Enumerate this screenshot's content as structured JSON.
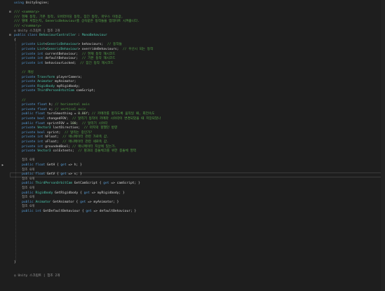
{
  "colors": {
    "background": "#1e1e1e",
    "comment": "#57a64a",
    "keyword": "#569cd6",
    "type": "#4ec9b0",
    "plain": "#d4d4d4",
    "method": "#dcdcaa",
    "number": "#b5cea8",
    "reference": "#9b9b9b"
  },
  "lines": [
    {
      "fold": "",
      "tokens": [
        {
          "c": "t-kw",
          "t": "using"
        },
        {
          "c": "t-plain",
          "t": " UnityEngine;"
        }
      ]
    },
    {
      "fold": "",
      "tokens": []
    },
    {
      "fold": "⊟",
      "tokens": [
        {
          "c": "t-comment",
          "t": "/// <summary>"
        }
      ]
    },
    {
      "fold": "",
      "tokens": [
        {
          "c": "t-comment",
          "t": "/// 현재 동작, 기본 동작, 오버라이딩 동작, 잠긴 동작, 마우스 이동값,"
        }
      ]
    },
    {
      "fold": "",
      "tokens": [
        {
          "c": "t-comment",
          "t": "/// 땅에 서있는지, GenericBehaviour를 상속받은 동작들을 업데이트 시켜줍니다."
        }
      ]
    },
    {
      "fold": "",
      "tokens": [
        {
          "c": "t-comment",
          "t": "/// </summary>"
        }
      ]
    },
    {
      "fold": "",
      "tokens": [
        {
          "c": "t-ref",
          "t": "◎ Unity 스크립트 | 참조 2개"
        }
      ]
    },
    {
      "fold": "⊟",
      "tokens": [
        {
          "c": "t-kw",
          "t": "public class "
        },
        {
          "c": "t-type",
          "t": "BehaviourController"
        },
        {
          "c": "t-plain",
          "t": " : "
        },
        {
          "c": "t-type",
          "t": "MonoBehaviour"
        }
      ]
    },
    {
      "fold": "",
      "tokens": [
        {
          "c": "t-plain",
          "t": "{"
        }
      ]
    },
    {
      "fold": "",
      "tokens": [
        {
          "c": "t-kw",
          "t": "    private "
        },
        {
          "c": "t-type",
          "t": "List"
        },
        {
          "c": "t-plain",
          "t": "<"
        },
        {
          "c": "t-type",
          "t": "GenericBehaviour"
        },
        {
          "c": "t-plain",
          "t": "> behaviours;  "
        },
        {
          "c": "t-comment",
          "t": "// 동작들"
        }
      ]
    },
    {
      "fold": "",
      "tokens": [
        {
          "c": "t-kw",
          "t": "    private "
        },
        {
          "c": "t-type",
          "t": "List"
        },
        {
          "c": "t-plain",
          "t": "<"
        },
        {
          "c": "t-type",
          "t": "GenericBehaviour"
        },
        {
          "c": "t-plain",
          "t": "> overrideBehaviours;  "
        },
        {
          "c": "t-comment",
          "t": "// 우선시 되는 동작"
        }
      ]
    },
    {
      "fold": "",
      "tokens": [
        {
          "c": "t-kw",
          "t": "    private int "
        },
        {
          "c": "t-plain",
          "t": "currentBehaviour;  "
        },
        {
          "c": "t-comment",
          "t": "// 현재 동작 해시코드"
        }
      ]
    },
    {
      "fold": "",
      "tokens": [
        {
          "c": "t-kw",
          "t": "    private int "
        },
        {
          "c": "t-plain",
          "t": "defaultBehaviour;  "
        },
        {
          "c": "t-comment",
          "t": "// 기본 동작 해시코드"
        }
      ]
    },
    {
      "fold": "",
      "tokens": [
        {
          "c": "t-kw",
          "t": "    private int "
        },
        {
          "c": "t-plain",
          "t": "behaviourLocked;  "
        },
        {
          "c": "t-comment",
          "t": "// 잠긴 동작 해시코드"
        }
      ]
    },
    {
      "fold": "",
      "tokens": []
    },
    {
      "fold": "",
      "tokens": [
        {
          "c": "t-comment",
          "t": "    // 캐싱"
        }
      ]
    },
    {
      "fold": "",
      "tokens": [
        {
          "c": "t-kw",
          "t": "    private "
        },
        {
          "c": "t-type",
          "t": "Transform"
        },
        {
          "c": "t-plain",
          "t": " playerCamera;"
        }
      ]
    },
    {
      "fold": "",
      "tokens": [
        {
          "c": "t-kw",
          "t": "    private "
        },
        {
          "c": "t-type",
          "t": "Animator"
        },
        {
          "c": "t-plain",
          "t": " myAnimator;"
        }
      ]
    },
    {
      "fold": "",
      "tokens": [
        {
          "c": "t-kw",
          "t": "    private "
        },
        {
          "c": "t-type",
          "t": "Rigidbody"
        },
        {
          "c": "t-plain",
          "t": " myRigidbody;"
        }
      ]
    },
    {
      "fold": "",
      "tokens": [
        {
          "c": "t-kw",
          "t": "    private "
        },
        {
          "c": "t-type",
          "t": "ThirdPersonOrbitCam"
        },
        {
          "c": "t-plain",
          "t": " camScript;"
        }
      ]
    },
    {
      "fold": "",
      "tokens": []
    },
    {
      "fold": "",
      "tokens": [
        {
          "c": "t-comment",
          "t": "    //"
        }
      ]
    },
    {
      "fold": "",
      "tokens": [
        {
          "c": "t-kw",
          "t": "    private float "
        },
        {
          "c": "t-plain",
          "t": "h; "
        },
        {
          "c": "t-comment",
          "t": "// horizontal axis"
        }
      ]
    },
    {
      "fold": "",
      "tokens": [
        {
          "c": "t-kw",
          "t": "    private float "
        },
        {
          "c": "t-plain",
          "t": "v; "
        },
        {
          "c": "t-comment",
          "t": "// vertical axis"
        }
      ]
    },
    {
      "fold": "",
      "tokens": [
        {
          "c": "t-kw",
          "t": "    public float "
        },
        {
          "c": "t-plain",
          "t": "turnSmoothing = "
        },
        {
          "c": "t-num",
          "t": "0.06f"
        },
        {
          "c": "t-plain",
          "t": "; "
        },
        {
          "c": "t-comment",
          "t": "// 카메라를 향하도록 움직일 때, 회전속도"
        }
      ]
    },
    {
      "fold": "",
      "tokens": [
        {
          "c": "t-kw",
          "t": "    private bool "
        },
        {
          "c": "t-plain",
          "t": "changedFOV;  "
        },
        {
          "c": "t-comment",
          "t": "// 달리기 동작이 카메라 시야각이 변경되었을 때 저장되었나"
        }
      ]
    },
    {
      "fold": "",
      "tokens": [
        {
          "c": "t-kw",
          "t": "    public float "
        },
        {
          "c": "t-plain",
          "t": "sprintFOV = "
        },
        {
          "c": "t-num",
          "t": "100"
        },
        {
          "c": "t-plain",
          "t": ";  "
        },
        {
          "c": "t-comment",
          "t": "// 달리기 시야각"
        }
      ]
    },
    {
      "fold": "",
      "tokens": [
        {
          "c": "t-kw",
          "t": "    private "
        },
        {
          "c": "t-type",
          "t": "Vector3"
        },
        {
          "c": "t-plain",
          "t": " lastDirection;  "
        },
        {
          "c": "t-comment",
          "t": "// 마지막 향했던 방향"
        }
      ]
    },
    {
      "fold": "",
      "tokens": [
        {
          "c": "t-kw",
          "t": "    private bool "
        },
        {
          "c": "t-plain",
          "t": "sprint;  "
        },
        {
          "c": "t-comment",
          "t": "// 달리는 중인가?"
        }
      ]
    },
    {
      "fold": "",
      "tokens": [
        {
          "c": "t-kw",
          "t": "    private int "
        },
        {
          "c": "t-plain",
          "t": "hFloat;  "
        },
        {
          "c": "t-comment",
          "t": "// 애니메이터 관련 가로축 값."
        }
      ]
    },
    {
      "fold": "",
      "tokens": [
        {
          "c": "t-kw",
          "t": "    private int "
        },
        {
          "c": "t-plain",
          "t": "vFloat;  "
        },
        {
          "c": "t-comment",
          "t": "// 애니메이터 관련 세로축 값."
        }
      ]
    },
    {
      "fold": "",
      "tokens": [
        {
          "c": "t-kw",
          "t": "    private int "
        },
        {
          "c": "t-plain",
          "t": "groundedBool; "
        },
        {
          "c": "t-comment",
          "t": "// 애니메이터 지상에 있는가."
        }
      ]
    },
    {
      "fold": "",
      "tokens": [
        {
          "c": "t-kw",
          "t": "    private "
        },
        {
          "c": "t-type",
          "t": "Vector3"
        },
        {
          "c": "t-plain",
          "t": " colExtents;  "
        },
        {
          "c": "t-comment",
          "t": "// 땅과의 충돌체크를 위한 충돌체 영역"
        }
      ]
    },
    {
      "fold": "",
      "tokens": []
    },
    {
      "fold": "",
      "tokens": [
        {
          "c": "t-ref",
          "t": "    참조 0개"
        }
      ]
    },
    {
      "fold": "",
      "tokens": [
        {
          "c": "t-kw",
          "t": "    public float "
        },
        {
          "c": "t-plain",
          "t": "GetH { "
        },
        {
          "c": "t-kw",
          "t": "get"
        },
        {
          "c": "t-plain",
          "t": " => h; }"
        }
      ]
    },
    {
      "fold": "",
      "tokens": [
        {
          "c": "t-ref",
          "t": "    참조 0개"
        }
      ]
    },
    {
      "fold": "",
      "tokens": [
        {
          "c": "t-kw",
          "t": "    public float "
        },
        {
          "c": "t-plain",
          "t": "GetV { "
        },
        {
          "c": "t-kw",
          "t": "get"
        },
        {
          "c": "t-plain",
          "t": " => v; }"
        }
      ]
    },
    {
      "fold": "",
      "tokens": [
        {
          "c": "t-ref",
          "t": "    참조 0개"
        }
      ]
    },
    {
      "fold": "",
      "tokens": [
        {
          "c": "t-kw",
          "t": "    public "
        },
        {
          "c": "t-type",
          "t": "ThirdPersonOrbitCam"
        },
        {
          "c": "t-plain",
          "t": " GetCamScript { "
        },
        {
          "c": "t-kw",
          "t": "get"
        },
        {
          "c": "t-plain",
          "t": " => camScript; }"
        }
      ]
    },
    {
      "fold": "",
      "tokens": [
        {
          "c": "t-ref",
          "t": "    참조 0개"
        }
      ]
    },
    {
      "fold": "",
      "tokens": [
        {
          "c": "t-kw",
          "t": "    public "
        },
        {
          "c": "t-type",
          "t": "Rigidbody"
        },
        {
          "c": "t-plain",
          "t": " GetRigidbody { "
        },
        {
          "c": "t-kw",
          "t": "get"
        },
        {
          "c": "t-plain",
          "t": " => myRigidbody; }"
        }
      ]
    },
    {
      "fold": "",
      "tokens": [
        {
          "c": "t-ref",
          "t": "    참조 0개"
        }
      ]
    },
    {
      "fold": "",
      "tokens": [
        {
          "c": "t-kw",
          "t": "    public "
        },
        {
          "c": "t-type",
          "t": "Animator"
        },
        {
          "c": "t-plain",
          "t": " GetAnimator { "
        },
        {
          "c": "t-kw",
          "t": "get"
        },
        {
          "c": "t-plain",
          "t": " => myAnimator; }"
        }
      ]
    },
    {
      "fold": "",
      "tokens": [
        {
          "c": "t-ref",
          "t": "    참조 0개"
        }
      ]
    },
    {
      "fold": "",
      "tokens": [
        {
          "c": "t-kw",
          "t": "    public int "
        },
        {
          "c": "t-plain",
          "t": "GetDefaultBehaviour { "
        },
        {
          "c": "t-kw",
          "t": "get"
        },
        {
          "c": "t-plain",
          "t": " => defaultBehaviour; }"
        }
      ]
    },
    {
      "fold": "",
      "tokens": []
    },
    {
      "fold": "",
      "tokens": []
    },
    {
      "fold": "",
      "tokens": []
    },
    {
      "fold": "",
      "tokens": []
    },
    {
      "fold": "",
      "tokens": []
    },
    {
      "fold": "",
      "tokens": []
    },
    {
      "fold": "",
      "tokens": []
    },
    {
      "fold": "",
      "tokens": []
    },
    {
      "fold": "",
      "tokens": []
    },
    {
      "fold": "",
      "tokens": []
    },
    {
      "fold": "",
      "tokens": [
        {
          "c": "t-plain",
          "t": "}"
        }
      ]
    },
    {
      "fold": "",
      "tokens": []
    },
    {
      "fold": "",
      "tokens": []
    },
    {
      "fold": "",
      "tokens": [
        {
          "c": "t-ref",
          "t": "◎ Unity 스크립트 | 참조 2개"
        }
      ]
    }
  ]
}
